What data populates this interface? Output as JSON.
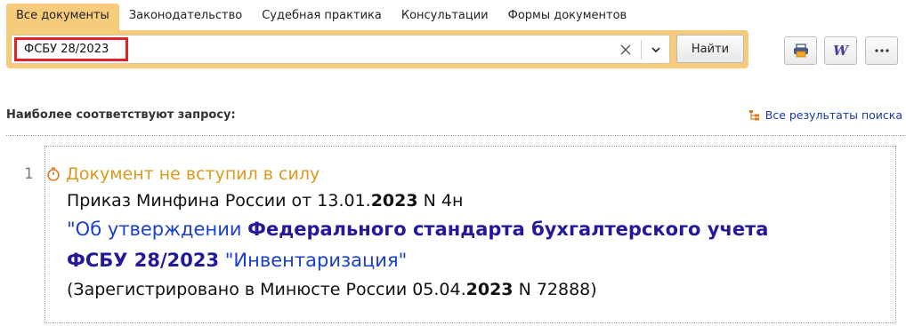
{
  "tabs": [
    {
      "label": "Все документы",
      "active": true
    },
    {
      "label": "Законодательство",
      "active": false
    },
    {
      "label": "Судебная практика",
      "active": false
    },
    {
      "label": "Консультации",
      "active": false
    },
    {
      "label": "Формы документов",
      "active": false
    }
  ],
  "search": {
    "value": "ФСБУ 28/2023",
    "clear_icon": "close-icon",
    "dropdown_icon": "chevron-down-icon",
    "find_label": "Найти"
  },
  "tools": {
    "print_icon": "printer-icon",
    "word_label": "W",
    "more_label": "•••"
  },
  "results": {
    "title": "Наиболее соответствуют запросу:",
    "all_results": "Все результаты поиска",
    "items": [
      {
        "number": "1",
        "status": "Документ не вступил в силу",
        "line1_pre": "Приказ Минфина России от 13.01.",
        "line1_bold": "2023",
        "line1_post": " N 4н",
        "line2_pre": "\"Об утверждении ",
        "line2_bold": "Федерального стандарта бухгалтерского учета",
        "line3_bold": "ФСБУ 28/2023",
        "line3_post": " \"Инвентаризация\"",
        "line4_pre": "(Зарегистрировано в Минюсте России 05.04.",
        "line4_bold": "2023",
        "line4_post": " N 72888)"
      }
    ]
  },
  "colors": {
    "tab_accent": "#f7cb7c",
    "search_highlight": "#e4202c",
    "status_orange": "#d99a1d",
    "title_blue": "#1a3fd0",
    "title_bold_blue": "#23199a"
  }
}
